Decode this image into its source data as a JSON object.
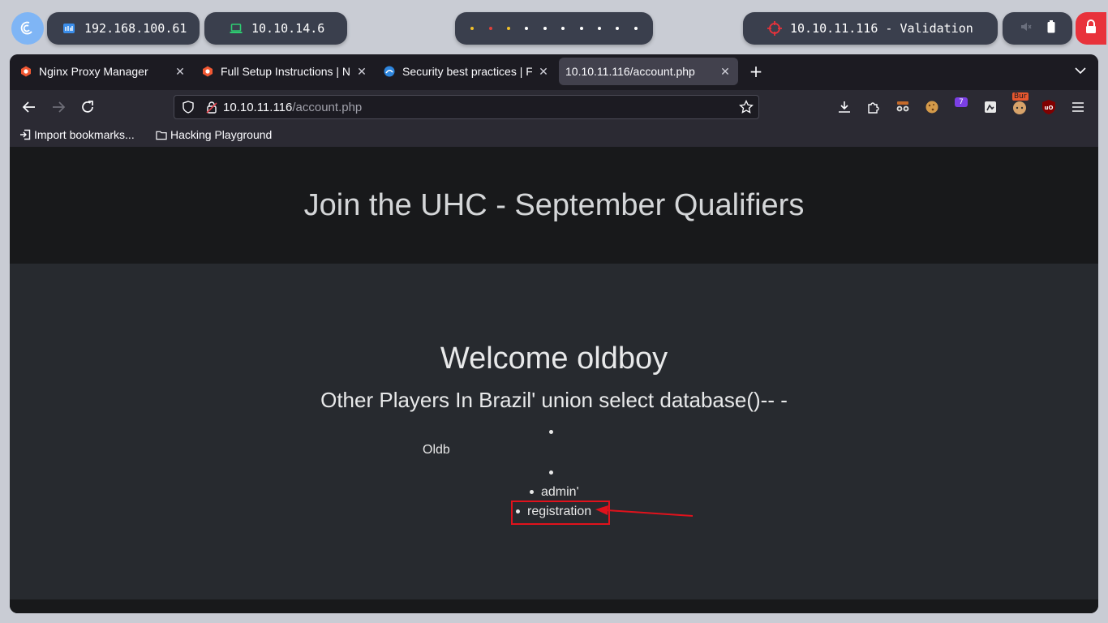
{
  "system_bar": {
    "ip_local": "192.168.100.61",
    "ip_vpn": "10.10.14.6",
    "target": "10.10.11.116 - Validation",
    "workspace_dot_colors": [
      "#f0c02a",
      "#e0403a",
      "#f0c02a",
      "#ffffff",
      "#ffffff",
      "#ffffff",
      "#ffffff",
      "#ffffff",
      "#ffffff",
      "#ffffff"
    ],
    "accent": "#e8323b"
  },
  "browser": {
    "tabs": [
      {
        "title": "Nginx Proxy Manager",
        "close": "✕",
        "icon": "nginx-proxy-icon"
      },
      {
        "title": "Full Setup Instructions | N",
        "close": "✕",
        "icon": "nginx-proxy-icon"
      },
      {
        "title": "Security best practices | F",
        "close": "✕",
        "icon": "docs-icon"
      },
      {
        "title": "10.10.11.116/account.php",
        "close": "✕",
        "icon": "none"
      }
    ],
    "new_tab": "+",
    "url_host": "10.10.11.116",
    "url_path": "/account.php",
    "extension_badge_count": "7",
    "burp_badge": "Bur",
    "bookmarks": [
      {
        "label": "Import bookmarks...",
        "icon": "import-icon"
      },
      {
        "label": "Hacking Playground",
        "icon": "folder-icon"
      }
    ]
  },
  "page": {
    "header_title": "Join the UHC - September Qualifiers",
    "welcome": "Welcome oldboy",
    "subtitle": "Other Players In Brazil' union select database()-- -",
    "list": {
      "db_name": "Oldb",
      "item_admin": "admin'",
      "item_registration": "registration"
    }
  }
}
